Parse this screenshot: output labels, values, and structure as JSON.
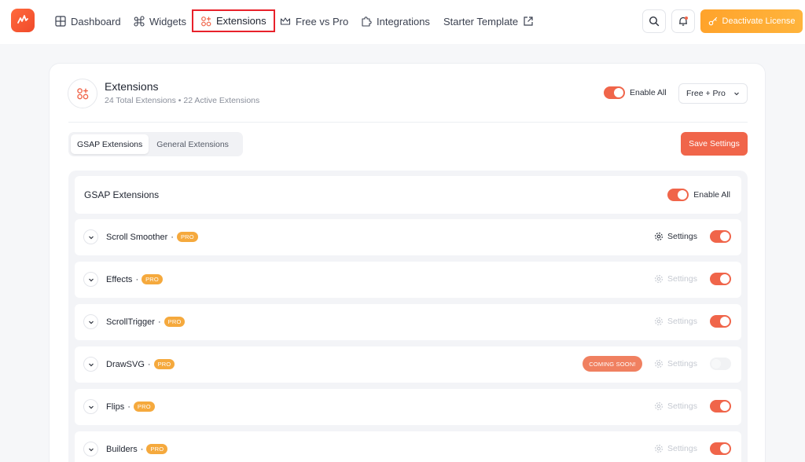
{
  "nav": {
    "items": [
      {
        "label": "Dashboard",
        "icon": "grid-icon"
      },
      {
        "label": "Widgets",
        "icon": "command-icon"
      },
      {
        "label": "Extensions",
        "icon": "extensions-icon",
        "active": true
      },
      {
        "label": "Free vs Pro",
        "icon": "crown-icon"
      },
      {
        "label": "Integrations",
        "icon": "puzzle-icon"
      },
      {
        "label": "Starter Template",
        "icon": "external-link-icon"
      }
    ],
    "deactivate_label": "Deactivate License"
  },
  "header": {
    "title": "Extensions",
    "subtitle": "24 Total Extensions • 22 Active Extensions",
    "enable_all_label": "Enable All",
    "filter_value": "Free + Pro"
  },
  "tabs": [
    {
      "label": "GSAP Extensions",
      "active": true
    },
    {
      "label": "General Extensions",
      "active": false
    }
  ],
  "save_label": "Save Settings",
  "panel": {
    "title": "GSAP Extensions",
    "enable_all_label": "Enable All",
    "rows": [
      {
        "name": "Scroll Smoother",
        "badge": "PRO",
        "settings": "Settings",
        "settings_enabled": true,
        "enabled": true
      },
      {
        "name": "Effects",
        "badge": "PRO",
        "settings": "Settings",
        "settings_enabled": false,
        "enabled": true
      },
      {
        "name": "ScrollTrigger",
        "badge": "PRO",
        "settings": "Settings",
        "settings_enabled": false,
        "enabled": true
      },
      {
        "name": "DrawSVG",
        "badge": "PRO",
        "settings": "Settings",
        "settings_enabled": false,
        "enabled": false,
        "coming_soon": "COMING SOON!"
      },
      {
        "name": "Flips",
        "badge": "PRO",
        "settings": "Settings",
        "settings_enabled": false,
        "enabled": true
      },
      {
        "name": "Builders",
        "badge": "PRO",
        "settings": "Settings",
        "settings_enabled": false,
        "enabled": true
      }
    ]
  },
  "colors": {
    "accent": "#f0654a",
    "pro_badge": "#f5a93d",
    "license_button": "#ffa32b"
  }
}
